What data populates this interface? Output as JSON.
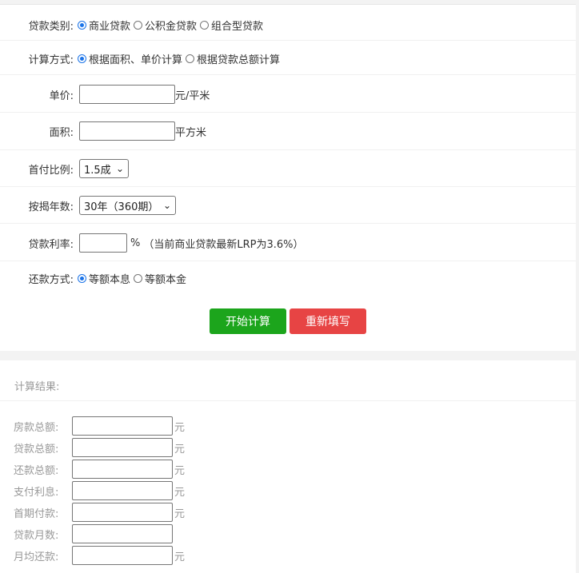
{
  "form": {
    "loan_type": {
      "label": "贷款类别:",
      "options": [
        "商业贷款",
        "公积金贷款",
        "组合型贷款"
      ],
      "selected": 0
    },
    "calc_method": {
      "label": "计算方式:",
      "options": [
        "根据面积、单价计算",
        "根据贷款总额计算"
      ],
      "selected": 0
    },
    "unit_price": {
      "label": "单价:",
      "value": "",
      "unit": "元/平米"
    },
    "area": {
      "label": "面积:",
      "value": "",
      "unit": "平方米"
    },
    "down_payment": {
      "label": "首付比例:",
      "selected": "1.5成"
    },
    "mortgage_years": {
      "label": "按揭年数:",
      "selected": "30年（360期）"
    },
    "interest_rate": {
      "label": "贷款利率:",
      "value": "",
      "unit": "%",
      "note": "（当前商业贷款最新LRP为3.6%）"
    },
    "repay_method": {
      "label": "还款方式:",
      "options": [
        "等额本息",
        "等额本金"
      ],
      "selected": 0
    },
    "buttons": {
      "calculate": "开始计算",
      "reset": "重新填写"
    }
  },
  "result": {
    "title": "计算结果:",
    "rows": [
      {
        "label": "房款总额:",
        "value": "",
        "unit": "元"
      },
      {
        "label": "贷款总额:",
        "value": "",
        "unit": "元"
      },
      {
        "label": "还款总额:",
        "value": "",
        "unit": "元"
      },
      {
        "label": "支付利息:",
        "value": "",
        "unit": "元"
      },
      {
        "label": "首期付款:",
        "value": "",
        "unit": "元"
      },
      {
        "label": "贷款月数:",
        "value": "",
        "unit": ""
      },
      {
        "label": "月均还款:",
        "value": "",
        "unit": "元"
      }
    ]
  },
  "colors": {
    "accent": "#1a73e8",
    "calc_button": "#1ca51c",
    "reset_button": "#e74444"
  }
}
